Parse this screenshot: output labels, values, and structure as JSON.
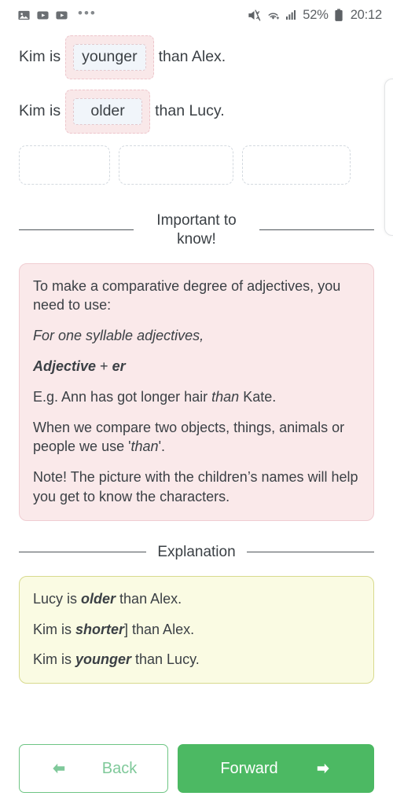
{
  "statusbar": {
    "left_icons": [
      {
        "name": "image-icon",
        "glyph": "image"
      },
      {
        "name": "video-play-icon-1",
        "glyph": "play"
      },
      {
        "name": "video-play-icon-2",
        "glyph": "play"
      }
    ],
    "overflow_label": "•••",
    "mute_icon": "mute-vibrate-icon",
    "wifi_icon": "wifi-plus-icon",
    "signal_icon": "cellular-signal-icon",
    "battery_percent": "52%",
    "battery_icon": "battery-icon",
    "time": "20:12"
  },
  "exercise": {
    "sentences": [
      {
        "prefix": "Kim is",
        "answer": "younger",
        "suffix": "than Alex."
      },
      {
        "prefix": "Kim is",
        "answer": "older",
        "suffix": "than Lucy."
      }
    ],
    "dropzones": [
      {
        "label": "",
        "index": "1"
      },
      {
        "label": "",
        "index": "2"
      },
      {
        "label": "",
        "index": "3"
      }
    ]
  },
  "important": {
    "divider_label": "Important to know!",
    "paragraphs": [
      {
        "id": "p1",
        "parts": [
          {
            "text": "To make a comparative degree of adjectives, you need to use:",
            "style": "normal"
          }
        ]
      },
      {
        "id": "p2",
        "parts": [
          {
            "text": "For one syllable adjectives,",
            "style": "italic"
          }
        ]
      },
      {
        "id": "p3",
        "parts": [
          {
            "text": "Adjective ",
            "style": "bold-italic"
          },
          {
            "text": "+",
            "style": "normal"
          },
          {
            "text": " er",
            "style": "bold-italic"
          }
        ]
      },
      {
        "id": "p4",
        "parts": [
          {
            "text": "E.g. Ann has got longer hair ",
            "style": "normal"
          },
          {
            "text": "than",
            "style": "italic"
          },
          {
            "text": " Kate.",
            "style": "normal"
          }
        ]
      },
      {
        "id": "p5",
        "parts": [
          {
            "text": "When we compare two objects, things, animals or people we use '",
            "style": "normal"
          },
          {
            "text": "than",
            "style": "italic"
          },
          {
            "text": "'.",
            "style": "normal"
          }
        ]
      },
      {
        "id": "p6",
        "parts": [
          {
            "text": "Note! The picture with the children’s names will help you get to know the characters.",
            "style": "normal"
          }
        ]
      }
    ]
  },
  "explanation": {
    "divider_label": "Explanation",
    "lines": [
      {
        "id": "e1",
        "parts": [
          {
            "text": "Lucy is ",
            "style": "normal"
          },
          {
            "text": "older",
            "style": "bold-italic"
          },
          {
            "text": " than Alex.",
            "style": "normal"
          }
        ]
      },
      {
        "id": "e2",
        "parts": [
          {
            "text": "Kim is ",
            "style": "normal"
          },
          {
            "text": "shorter",
            "style": "bold-italic"
          },
          {
            "text": "] than Alex.",
            "style": "normal"
          }
        ]
      },
      {
        "id": "e3",
        "parts": [
          {
            "text": "Kim is ",
            "style": "normal"
          },
          {
            "text": "younger",
            "style": "bold-italic"
          },
          {
            "text": " than Lucy.",
            "style": "normal"
          }
        ]
      }
    ]
  },
  "footer": {
    "back_label": "Back",
    "forward_label": "Forward",
    "back_icon": "arrow-left-icon",
    "forward_icon": "arrow-right-icon"
  },
  "colors": {
    "accent_green": "#4cb963",
    "back_green": "#7fc99a",
    "pink_bg": "#fae9ea",
    "pink_border": "#f0cdd2",
    "yellow_bg": "#fafbe3",
    "yellow_border": "#d8da8e",
    "chip_outer_bg": "#f9e8e9",
    "chip_inner_bg": "#f1f5fa",
    "text": "#3b4045"
  }
}
